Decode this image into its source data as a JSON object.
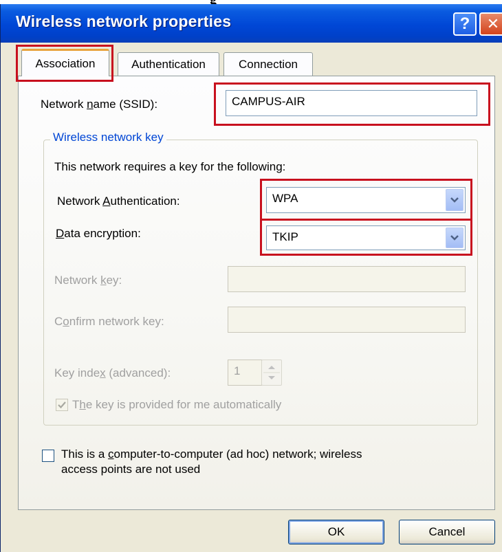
{
  "top_fragment": "g",
  "window": {
    "title": "Wireless network properties",
    "help_glyph": "?",
    "close_glyph": "✕"
  },
  "tabs": [
    {
      "label": "Association",
      "selected": true
    },
    {
      "label": "Authentication",
      "selected": false
    },
    {
      "label": "Connection",
      "selected": false
    }
  ],
  "association": {
    "ssid_label_pre": "Network ",
    "ssid_label_key": "n",
    "ssid_label_post": "ame (SSID):",
    "ssid_value": "CAMPUS-AIR",
    "group_title": "Wireless network key",
    "key_intro": "This network requires a key for the following:",
    "auth_label_pre": "Network ",
    "auth_label_key": "A",
    "auth_label_post": "uthentication:",
    "auth_value": "WPA",
    "enc_label_key": "D",
    "enc_label_post": "ata encryption:",
    "enc_value": "TKIP",
    "netkey_label_pre": "Network ",
    "netkey_label_key": "k",
    "netkey_label_post": "ey:",
    "confirm_label_pre": "C",
    "confirm_label_key": "o",
    "confirm_label_post": "nfirm network key:",
    "keyindex_label_pre": "Key inde",
    "keyindex_label_key": "x",
    "keyindex_label_post": " (advanced):",
    "keyindex_value": "1",
    "auto_key_pre": "T",
    "auto_key_key": "h",
    "auto_key_post": "e key is provided for me automatically",
    "auto_key_checked": true,
    "adhoc_line1_pre": "This is a ",
    "adhoc_line1_key": "c",
    "adhoc_line1_post": "omputer-to-computer (ad hoc) network; wireless",
    "adhoc_line2": "access points are not used",
    "adhoc_checked": false
  },
  "buttons": {
    "ok": "OK",
    "cancel": "Cancel"
  },
  "colors": {
    "highlight": "#c8101e",
    "titlebar": "#0047d6",
    "group_title": "#0046d5"
  }
}
